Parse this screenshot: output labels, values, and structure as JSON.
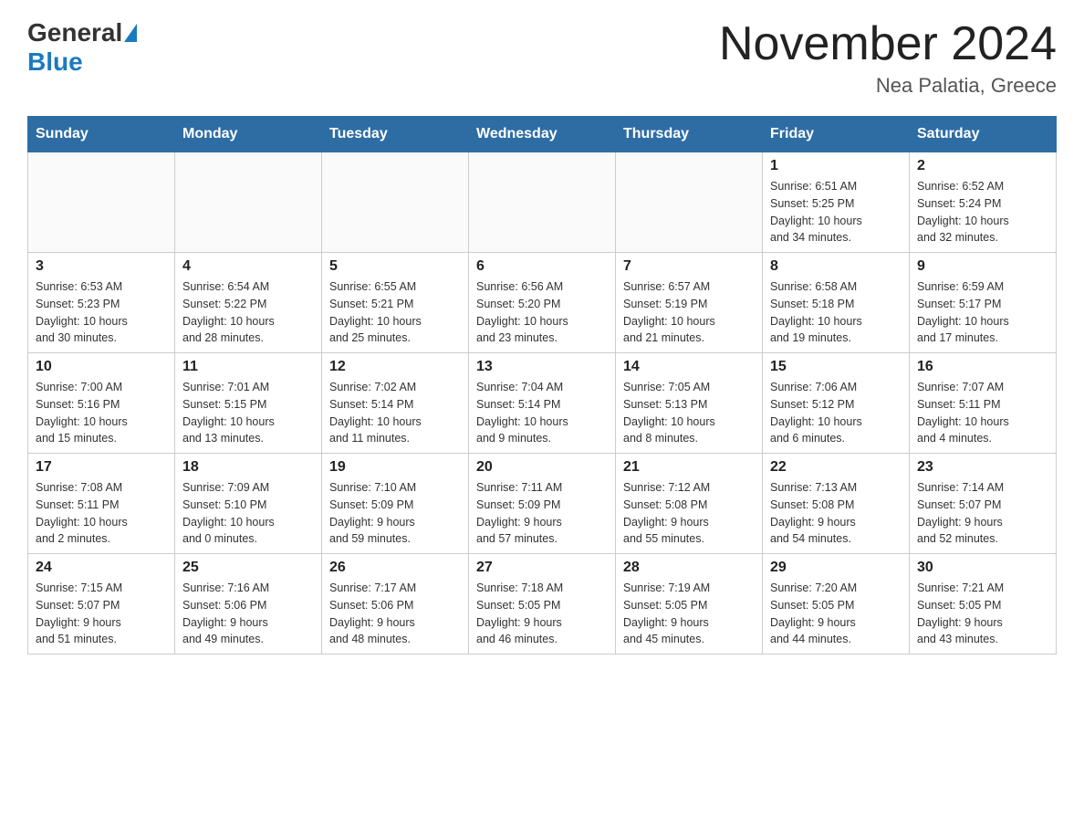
{
  "logo": {
    "general": "General",
    "blue": "Blue"
  },
  "title": "November 2024",
  "location": "Nea Palatia, Greece",
  "weekdays": [
    "Sunday",
    "Monday",
    "Tuesday",
    "Wednesday",
    "Thursday",
    "Friday",
    "Saturday"
  ],
  "weeks": [
    [
      {
        "day": "",
        "info": ""
      },
      {
        "day": "",
        "info": ""
      },
      {
        "day": "",
        "info": ""
      },
      {
        "day": "",
        "info": ""
      },
      {
        "day": "",
        "info": ""
      },
      {
        "day": "1",
        "info": "Sunrise: 6:51 AM\nSunset: 5:25 PM\nDaylight: 10 hours\nand 34 minutes."
      },
      {
        "day": "2",
        "info": "Sunrise: 6:52 AM\nSunset: 5:24 PM\nDaylight: 10 hours\nand 32 minutes."
      }
    ],
    [
      {
        "day": "3",
        "info": "Sunrise: 6:53 AM\nSunset: 5:23 PM\nDaylight: 10 hours\nand 30 minutes."
      },
      {
        "day": "4",
        "info": "Sunrise: 6:54 AM\nSunset: 5:22 PM\nDaylight: 10 hours\nand 28 minutes."
      },
      {
        "day": "5",
        "info": "Sunrise: 6:55 AM\nSunset: 5:21 PM\nDaylight: 10 hours\nand 25 minutes."
      },
      {
        "day": "6",
        "info": "Sunrise: 6:56 AM\nSunset: 5:20 PM\nDaylight: 10 hours\nand 23 minutes."
      },
      {
        "day": "7",
        "info": "Sunrise: 6:57 AM\nSunset: 5:19 PM\nDaylight: 10 hours\nand 21 minutes."
      },
      {
        "day": "8",
        "info": "Sunrise: 6:58 AM\nSunset: 5:18 PM\nDaylight: 10 hours\nand 19 minutes."
      },
      {
        "day": "9",
        "info": "Sunrise: 6:59 AM\nSunset: 5:17 PM\nDaylight: 10 hours\nand 17 minutes."
      }
    ],
    [
      {
        "day": "10",
        "info": "Sunrise: 7:00 AM\nSunset: 5:16 PM\nDaylight: 10 hours\nand 15 minutes."
      },
      {
        "day": "11",
        "info": "Sunrise: 7:01 AM\nSunset: 5:15 PM\nDaylight: 10 hours\nand 13 minutes."
      },
      {
        "day": "12",
        "info": "Sunrise: 7:02 AM\nSunset: 5:14 PM\nDaylight: 10 hours\nand 11 minutes."
      },
      {
        "day": "13",
        "info": "Sunrise: 7:04 AM\nSunset: 5:14 PM\nDaylight: 10 hours\nand 9 minutes."
      },
      {
        "day": "14",
        "info": "Sunrise: 7:05 AM\nSunset: 5:13 PM\nDaylight: 10 hours\nand 8 minutes."
      },
      {
        "day": "15",
        "info": "Sunrise: 7:06 AM\nSunset: 5:12 PM\nDaylight: 10 hours\nand 6 minutes."
      },
      {
        "day": "16",
        "info": "Sunrise: 7:07 AM\nSunset: 5:11 PM\nDaylight: 10 hours\nand 4 minutes."
      }
    ],
    [
      {
        "day": "17",
        "info": "Sunrise: 7:08 AM\nSunset: 5:11 PM\nDaylight: 10 hours\nand 2 minutes."
      },
      {
        "day": "18",
        "info": "Sunrise: 7:09 AM\nSunset: 5:10 PM\nDaylight: 10 hours\nand 0 minutes."
      },
      {
        "day": "19",
        "info": "Sunrise: 7:10 AM\nSunset: 5:09 PM\nDaylight: 9 hours\nand 59 minutes."
      },
      {
        "day": "20",
        "info": "Sunrise: 7:11 AM\nSunset: 5:09 PM\nDaylight: 9 hours\nand 57 minutes."
      },
      {
        "day": "21",
        "info": "Sunrise: 7:12 AM\nSunset: 5:08 PM\nDaylight: 9 hours\nand 55 minutes."
      },
      {
        "day": "22",
        "info": "Sunrise: 7:13 AM\nSunset: 5:08 PM\nDaylight: 9 hours\nand 54 minutes."
      },
      {
        "day": "23",
        "info": "Sunrise: 7:14 AM\nSunset: 5:07 PM\nDaylight: 9 hours\nand 52 minutes."
      }
    ],
    [
      {
        "day": "24",
        "info": "Sunrise: 7:15 AM\nSunset: 5:07 PM\nDaylight: 9 hours\nand 51 minutes."
      },
      {
        "day": "25",
        "info": "Sunrise: 7:16 AM\nSunset: 5:06 PM\nDaylight: 9 hours\nand 49 minutes."
      },
      {
        "day": "26",
        "info": "Sunrise: 7:17 AM\nSunset: 5:06 PM\nDaylight: 9 hours\nand 48 minutes."
      },
      {
        "day": "27",
        "info": "Sunrise: 7:18 AM\nSunset: 5:05 PM\nDaylight: 9 hours\nand 46 minutes."
      },
      {
        "day": "28",
        "info": "Sunrise: 7:19 AM\nSunset: 5:05 PM\nDaylight: 9 hours\nand 45 minutes."
      },
      {
        "day": "29",
        "info": "Sunrise: 7:20 AM\nSunset: 5:05 PM\nDaylight: 9 hours\nand 44 minutes."
      },
      {
        "day": "30",
        "info": "Sunrise: 7:21 AM\nSunset: 5:05 PM\nDaylight: 9 hours\nand 43 minutes."
      }
    ]
  ]
}
